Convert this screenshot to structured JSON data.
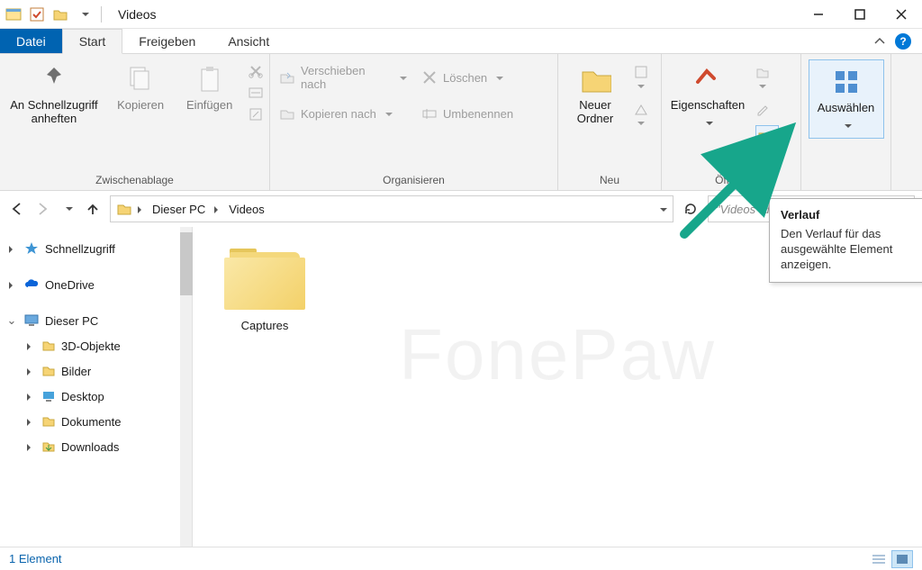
{
  "window": {
    "title": "Videos"
  },
  "tabs": {
    "file": "Datei",
    "start": "Start",
    "share": "Freigeben",
    "view": "Ansicht"
  },
  "ribbon": {
    "clipboard": {
      "pin": "An Schnellzugriff anheften",
      "copy": "Kopieren",
      "paste": "Einfügen",
      "label": "Zwischenablage"
    },
    "organize": {
      "move_to": "Verschieben nach",
      "copy_to": "Kopieren nach",
      "delete": "Löschen",
      "rename": "Umbenennen",
      "label": "Organisieren"
    },
    "new": {
      "new_folder": "Neuer Ordner",
      "label": "Neu"
    },
    "open": {
      "properties": "Eigenschaften",
      "label": "Öffnen"
    },
    "select": {
      "select": "Auswählen"
    }
  },
  "breadcrumb": {
    "items": [
      "Dieser PC",
      "Videos"
    ]
  },
  "search": {
    "placeholder": "\"Videos\" durchsuchen"
  },
  "tree": {
    "quick_access": "Schnellzugriff",
    "onedrive": "OneDrive",
    "this_pc": "Dieser PC",
    "children": [
      "3D-Objekte",
      "Bilder",
      "Desktop",
      "Dokumente",
      "Downloads"
    ]
  },
  "content": {
    "folder": "Captures",
    "watermark": "FonePaw"
  },
  "status": {
    "count": "1 Element"
  },
  "tooltip": {
    "title": "Verlauf",
    "body": "Den Verlauf für das ausgewählte Element anzeigen."
  }
}
